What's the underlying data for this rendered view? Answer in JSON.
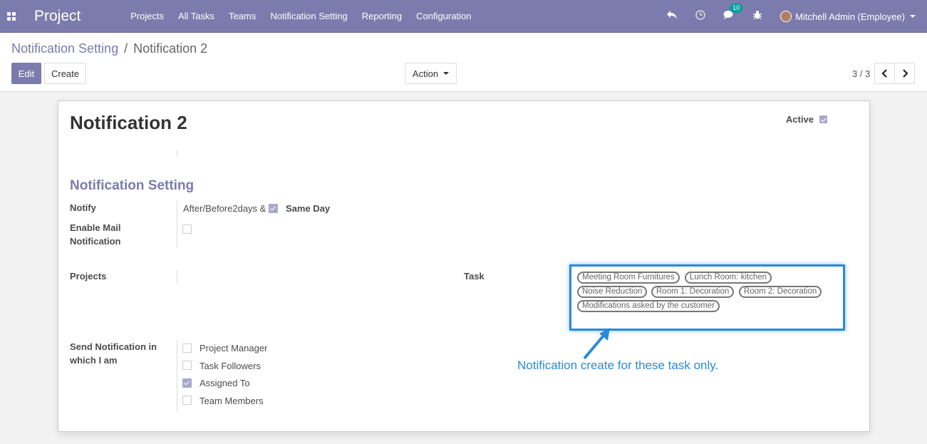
{
  "navbar": {
    "brand": "Project",
    "menu": [
      "Projects",
      "All Tasks",
      "Teams",
      "Notification Setting",
      "Reporting",
      "Configuration"
    ],
    "chat_count": "10",
    "user": "Mitchell Admin (Employee)"
  },
  "breadcrumb": {
    "parent": "Notification Setting",
    "separator": "/",
    "current": "Notification 2"
  },
  "buttons": {
    "edit": "Edit",
    "create": "Create",
    "action": "Action"
  },
  "pager": {
    "value": "3 / 3"
  },
  "form": {
    "title": "Notification 2",
    "active_label": "Active",
    "active_checked": true,
    "section_title": "Notification Setting",
    "notify_label": "Notify",
    "notify_value": "After/Before2days &",
    "same_day_label": "Same Day",
    "enable_mail_label": "Enable Mail Notification",
    "enable_mail_checked": false,
    "projects_label": "Projects",
    "task_label": "Task",
    "tasks": [
      "Meeting Room Furnitures",
      "Lunch Room: kitchen",
      "Noise Reduction",
      "Room 1: Decoration",
      "Room 2: Decoration",
      "Modifications asked by the customer"
    ],
    "send_label": "Send Notification in which I am",
    "send_options": [
      {
        "label": "Project Manager",
        "checked": false
      },
      {
        "label": "Task Followers",
        "checked": false
      },
      {
        "label": "Assigned To",
        "checked": true
      },
      {
        "label": "Team Members",
        "checked": false
      }
    ]
  },
  "annotation": {
    "text": "Notification create for these task only.",
    "color": "#2a8ad8"
  },
  "colors": {
    "brand": "#7c7bad",
    "accent": "#00a09d"
  }
}
